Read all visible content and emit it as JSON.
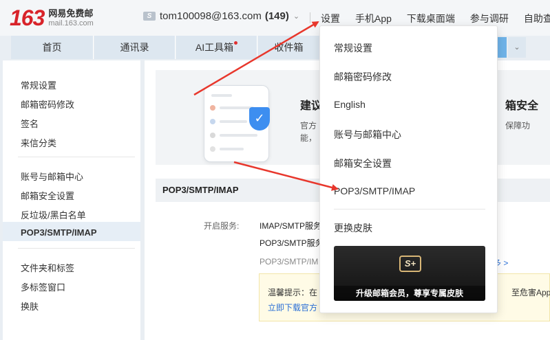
{
  "header": {
    "logo_number": "163",
    "logo_cn": "网易免费邮",
    "logo_url": "mail.163.com",
    "account_icon": "S",
    "account_email": "tom100098@163.com",
    "account_count": "(149)",
    "nav": [
      "设置",
      "手机App",
      "下载桌面端",
      "参与调研",
      "自助查"
    ]
  },
  "tabs": [
    {
      "label": "首页"
    },
    {
      "label": "通讯录"
    },
    {
      "label": "AI工具箱"
    },
    {
      "label": "收件箱"
    }
  ],
  "sidebar": {
    "groups": [
      [
        "常规设置",
        "邮箱密码修改",
        "签名",
        "来信分类"
      ],
      [
        "账号与邮箱中心",
        "邮箱安全设置",
        "反垃圾/黑白名单",
        "POP3/SMTP/IMAP"
      ],
      [
        "文件夹和标签",
        "多标签窗口",
        "换肤"
      ]
    ],
    "active": "POP3/SMTP/IMAP"
  },
  "banner": {
    "title_left": "建议",
    "sub_left_1": "官方",
    "sub_left_2": "能，",
    "title_right": "箱安全",
    "sub_right": "保障功"
  },
  "section": {
    "title": "POP3/SMTP/IMAP",
    "service_label": "开启服务:",
    "service_lines": [
      "IMAP/SMTP服务",
      "POP3/SMTP服务"
    ],
    "more_text": "POP3/SMTP/IM",
    "more_link": "多 >"
  },
  "tip": {
    "text": "温馨提示：在",
    "right_text": "至危害Apple",
    "link": "立即下载官方"
  },
  "dropdown": {
    "items": [
      "常规设置",
      "邮箱密码修改",
      "English",
      "账号与邮箱中心",
      "邮箱安全设置",
      "POP3/SMTP/IMAP",
      "更换皮肤"
    ],
    "promo_badge": "S+",
    "promo_text": "升级邮箱会员，尊享专属皮肤"
  },
  "colors": {
    "brand_red": "#d8232a",
    "arrow_red": "#e8372c",
    "link_blue": "#2a6fd6",
    "active_bg": "#e6eef6"
  }
}
